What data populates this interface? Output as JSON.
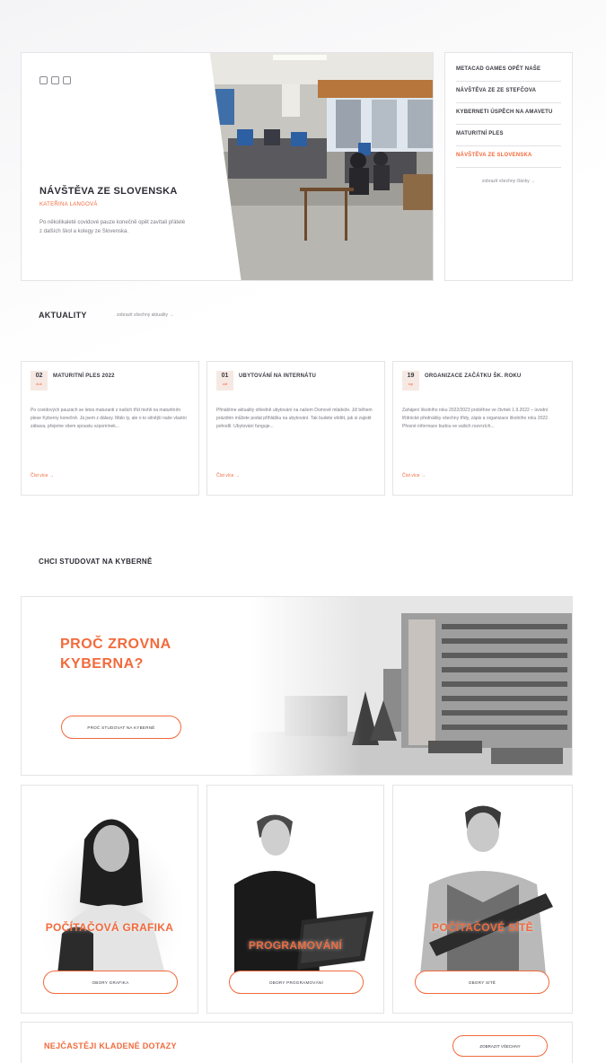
{
  "hero": {
    "title": "NÁVŠTĚVA ZE SLOVENSKA",
    "author": "KATEŘINA LANGOVÁ",
    "description": "Po několikaleté covidové pauze konečně opět zavítali přátelé z dalších škol a kolegy ze Slovenska.",
    "dots": [
      "dot-1",
      "dot-2",
      "dot-3"
    ]
  },
  "news_list": {
    "items": [
      {
        "label": "METACAD GAMES OPĚT NAŠE",
        "active": false
      },
      {
        "label": "NÁVŠTĚVA ZE ZE STEFČOVA",
        "active": false
      },
      {
        "label": "KYBERNETI ÚSPĚCH NA AMAVETU",
        "active": false
      },
      {
        "label": "MATURITNÍ PLES",
        "active": false
      },
      {
        "label": "NÁVŠTĚVA ZE SLOVENSKA",
        "active": true
      }
    ],
    "more_label": "zobrazit všechny články →"
  },
  "aktuality": {
    "title": "AKTUALITY",
    "link": "zobrazit všechny aktuality →",
    "cards": [
      {
        "day": "02",
        "month": "dub",
        "title": "MATURITNÍ PLES 2022",
        "text": "Po covidových pauzách se letos maturanti z našich tříd mohli na maturitním plese Kyberny konečně. Já jsem z dálavy. Málo ty, ale o to silnější naše vlastní zábava, přejeme všem spoustu vzpomínek...",
        "more": "Číst více →"
      },
      {
        "day": "01",
        "month": "zář",
        "title": "UBYTOVÁNÍ NA INTERNÁTU",
        "text": "Přinášíme aktuality ohledně ubytování na našem Domově mládeže. Již během prázdnin můžete podat přihlášku na ubytování. Tak budete vědět, jak si zajistit pohodlí. Ubytování funguje...",
        "more": "Číst více →"
      },
      {
        "day": "19",
        "month": "srp",
        "title": "ORGANIZACE ZAČÁTKU ŠK. ROKU",
        "text": "Zahájení školního roku 2022/2023 proběhne ve čtvrtek 1.9.2022 – úvodní třídnické přednášky všechny třídy, zápis a organizace školního roku 2022. Přesné informace budou ve vašich rozvrzích...",
        "more": "Číst více →"
      }
    ]
  },
  "chci": {
    "title": "CHCI STUDOVAT NA KYBERNĚ",
    "why_title": "PROČ ZROVNA KYBERNA?",
    "why_button": "PROČ STUDOVAT NA KYBERNĚ",
    "programs": [
      {
        "label": "POČÍTAČOVÁ GRAFIKA",
        "button": "OBORY GRAFIKA"
      },
      {
        "label": "PROGRAMOVÁNÍ",
        "button": "OBORY PROGRAMOVÁNÍ"
      },
      {
        "label": "POČÍTAČOVÉ SÍTĚ",
        "button": "OBORY SÍTĚ"
      }
    ]
  },
  "faq": {
    "title": "NEJČASTĚJI KLADENÉ DOTAZY",
    "button": "ZOBRAZIT VŠECHNY"
  },
  "colors": {
    "accent": "#f26a3c",
    "text": "#2c2c34",
    "muted": "#7a7a82",
    "border": "#e4e4e8"
  }
}
